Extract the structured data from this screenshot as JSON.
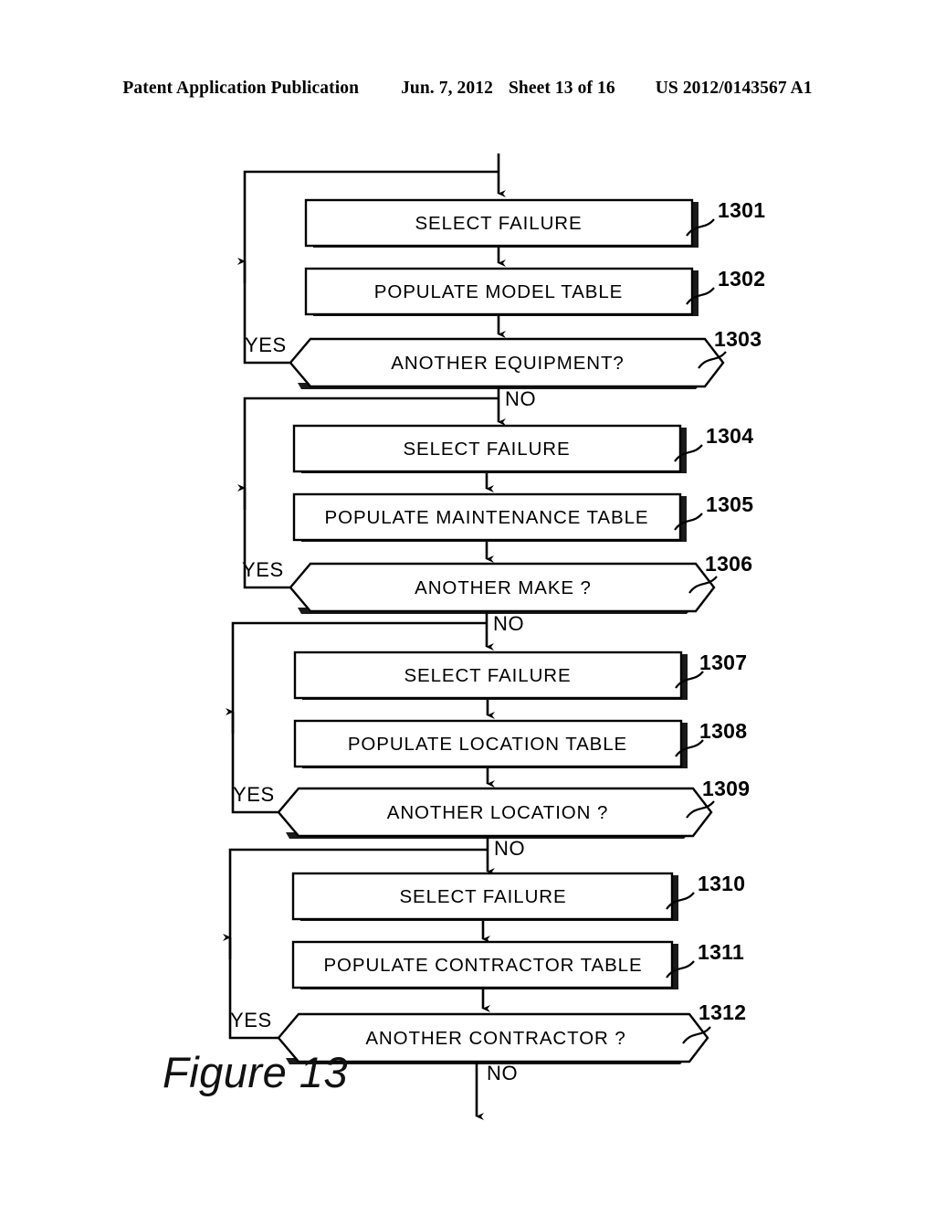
{
  "header": {
    "publication": "Patent Application Publication",
    "date": "Jun. 7, 2012",
    "sheet": "Sheet 13 of 16",
    "patent_number": "US 2012/0143567 A1"
  },
  "figure": {
    "caption": "Figure 13"
  },
  "flowchart": {
    "branch_yes": "YES",
    "branch_no": "NO",
    "sections": [
      {
        "select": {
          "label": "SELECT FAILURE",
          "ref": "1301"
        },
        "populate": {
          "label": "POPULATE MODEL TABLE",
          "ref": "1302"
        },
        "decision": {
          "label": "ANOTHER EQUIPMENT?",
          "ref": "1303"
        }
      },
      {
        "select": {
          "label": "SELECT FAILURE",
          "ref": "1304"
        },
        "populate": {
          "label": "POPULATE MAINTENANCE TABLE",
          "ref": "1305"
        },
        "decision": {
          "label": "ANOTHER MAKE ?",
          "ref": "1306"
        }
      },
      {
        "select": {
          "label": "SELECT FAILURE",
          "ref": "1307"
        },
        "populate": {
          "label": "POPULATE LOCATION TABLE",
          "ref": "1308"
        },
        "decision": {
          "label": "ANOTHER LOCATION ?",
          "ref": "1309"
        }
      },
      {
        "select": {
          "label": "SELECT FAILURE",
          "ref": "1310"
        },
        "populate": {
          "label": "POPULATE CONTRACTOR TABLE",
          "ref": "1311"
        },
        "decision": {
          "label": "ANOTHER CONTRACTOR ?",
          "ref": "1312"
        }
      }
    ]
  },
  "colors": {
    "ink": "#000000",
    "paper": "#ffffff",
    "shadow": "#1a1a1a"
  }
}
